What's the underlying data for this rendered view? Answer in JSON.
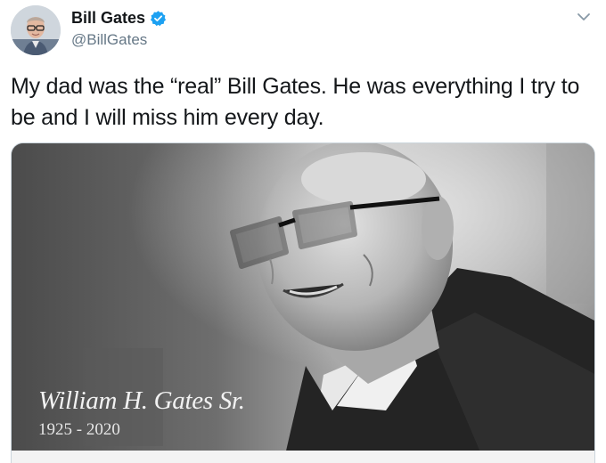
{
  "header": {
    "display_name": "Bill Gates",
    "handle": "@BillGates",
    "verified_icon": "verified-badge-icon",
    "menu_icon": "chevron-down-icon",
    "verified_color": "#1da1f2"
  },
  "tweet": {
    "text": "My dad was the “real” Bill Gates. He was everything I try to be and I will miss him every day."
  },
  "media": {
    "caption_name": "William H. Gates Sr.",
    "caption_years": "1925 - 2020"
  },
  "colors": {
    "text_primary": "#14171a",
    "text_secondary": "#657786",
    "border": "#ccd6dd"
  }
}
